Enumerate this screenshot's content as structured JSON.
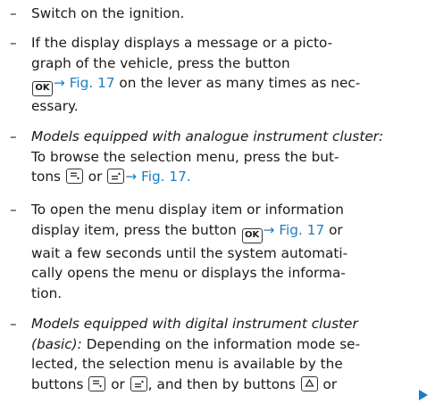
{
  "dash": "–",
  "ok": "OK",
  "fig": "Fig. 17",
  "arrow_text": "→",
  "steps": [
    {
      "lines": [
        "Switch on the ignition."
      ]
    },
    {
      "lines": [
        "If the display displays a message or a picto-",
        "graph of the vehicle, press the button",
        "on the lever as many times as nec-",
        "essary."
      ]
    },
    {
      "prefix": "Models equipped with analogue instrument cluster:",
      "lines": [
        "To browse the selection menu, press the but-",
        "tons",
        "or"
      ]
    },
    {
      "lines": [
        "To open the menu display item or information",
        "display item, press the button",
        "or",
        "wait a few seconds until the system automati-",
        "cally opens the menu or displays the information",
        "tion."
      ]
    },
    {
      "prefix_lines": [
        "Models equipped with digital instrument cluster",
        "(basic):"
      ],
      "lines": [
        "Depending on the information mode se-",
        "lected, the selection menu is available by the",
        "buttons",
        "or",
        ", and then by buttons",
        "or"
      ]
    }
  ],
  "fix": {
    "step3_line4": "cally opens the menu or displays the informa-"
  },
  "continue_icon": "continue-arrow-icon"
}
